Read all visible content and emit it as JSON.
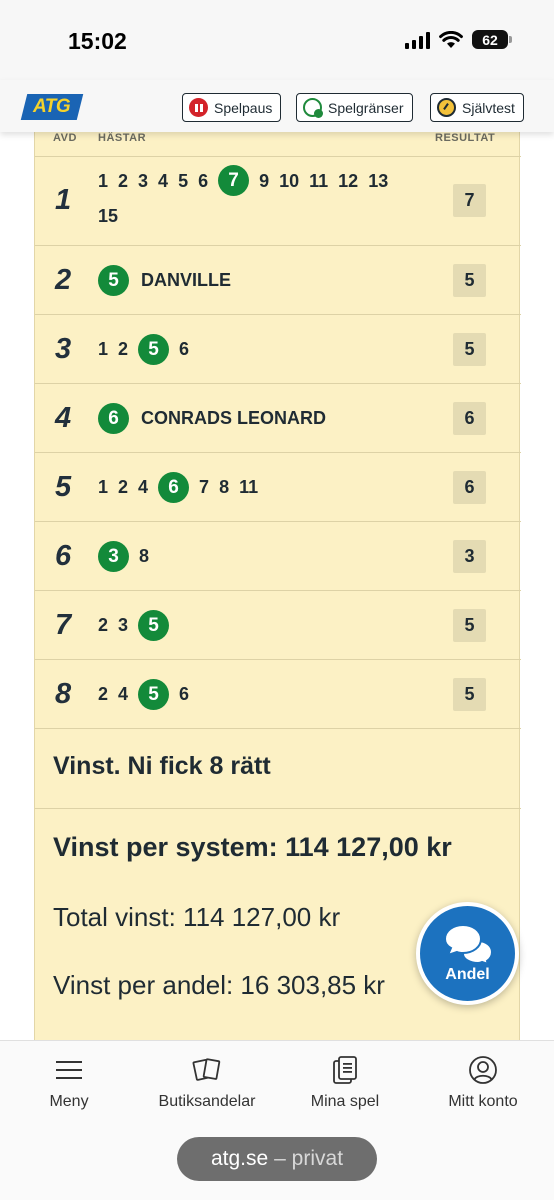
{
  "status_bar": {
    "time": "15:02",
    "battery": "62"
  },
  "header": {
    "logo": "ATG",
    "buttons": [
      {
        "label": "Spelpaus"
      },
      {
        "label": "Spelgränser"
      },
      {
        "label": "Självtest"
      }
    ]
  },
  "table": {
    "columns": {
      "avd": "AVD",
      "hastar": "HÄSTAR",
      "resultat": "RESULTAT"
    },
    "rows": [
      {
        "avd": "1",
        "horses": [
          "1",
          "2",
          "3",
          "4",
          "5",
          "6",
          "7",
          "9",
          "10",
          "11",
          "12",
          "13",
          "15"
        ],
        "winner": "7",
        "name": "",
        "result": "7"
      },
      {
        "avd": "2",
        "horses": [
          "5"
        ],
        "winner": "5",
        "name": "DANVILLE",
        "result": "5"
      },
      {
        "avd": "3",
        "horses": [
          "1",
          "2",
          "5",
          "6"
        ],
        "winner": "5",
        "name": "",
        "result": "5"
      },
      {
        "avd": "4",
        "horses": [
          "6"
        ],
        "winner": "6",
        "name": "CONRADS LEONARD",
        "result": "6"
      },
      {
        "avd": "5",
        "horses": [
          "1",
          "2",
          "4",
          "6",
          "7",
          "8",
          "11"
        ],
        "winner": "6",
        "name": "",
        "result": "6"
      },
      {
        "avd": "6",
        "horses": [
          "3",
          "8"
        ],
        "winner": "3",
        "name": "",
        "result": "3"
      },
      {
        "avd": "7",
        "horses": [
          "2",
          "3",
          "5"
        ],
        "winner": "5",
        "name": "",
        "result": "5"
      },
      {
        "avd": "8",
        "horses": [
          "2",
          "4",
          "5",
          "6"
        ],
        "winner": "5",
        "name": "",
        "result": "5"
      }
    ]
  },
  "summary": {
    "title": "Vinst. Ni fick 8 rätt",
    "per_system": "Vinst per system: 114 127,00 kr",
    "total": "Total vinst: 114 127,00 kr",
    "per_share": "Vinst per andel: 16 303,85 kr"
  },
  "fab": {
    "label": "Andel"
  },
  "bottom_nav": [
    {
      "label": "Meny",
      "icon": "menu-icon"
    },
    {
      "label": "Butiksandelar",
      "icon": "cards-icon"
    },
    {
      "label": "Mina spel",
      "icon": "coupons-icon"
    },
    {
      "label": "Mitt konto",
      "icon": "user-icon"
    }
  ],
  "url_bar": {
    "domain": "atg.se",
    "mode": "– privat"
  },
  "colors": {
    "winner": "#138a3a",
    "background": "#fcf1c5",
    "accent": "#1c72bf"
  }
}
